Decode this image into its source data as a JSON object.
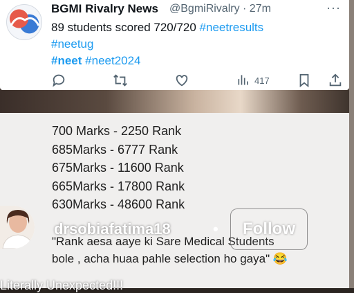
{
  "tweet": {
    "name": "BGMI Rivalry News",
    "handle": "@BgmiRivalry · 27m",
    "text_line1": "89 students scored 720/720 ",
    "tag_neetresults": "#neetresults",
    "tag_neetug": "#neetug",
    "tag_neet": "#neet",
    "tag_neet2024": "#neet2024",
    "views": "417"
  },
  "ranks": [
    "700 Marks - 2250 Rank",
    "685Marks - 6777 Rank",
    "675Marks - 11600 Rank",
    "665Marks - 17800 Rank",
    "630Marks - 48600 Rank"
  ],
  "quote_line1": "\"Rank aesa aaye ki Sare Medical Students",
  "quote_line2": "bole , acha huaa pahle selection ho gaya\" 😂",
  "overlay": {
    "username": "drsobiafatima18",
    "dot": "•",
    "follow_label": "Follow",
    "caption": "Literally Unexpected!!!"
  },
  "icons": [
    "reply-icon",
    "retweet-icon",
    "like-icon",
    "views-icon",
    "bookmark-icon",
    "share-icon",
    "more-icon"
  ]
}
